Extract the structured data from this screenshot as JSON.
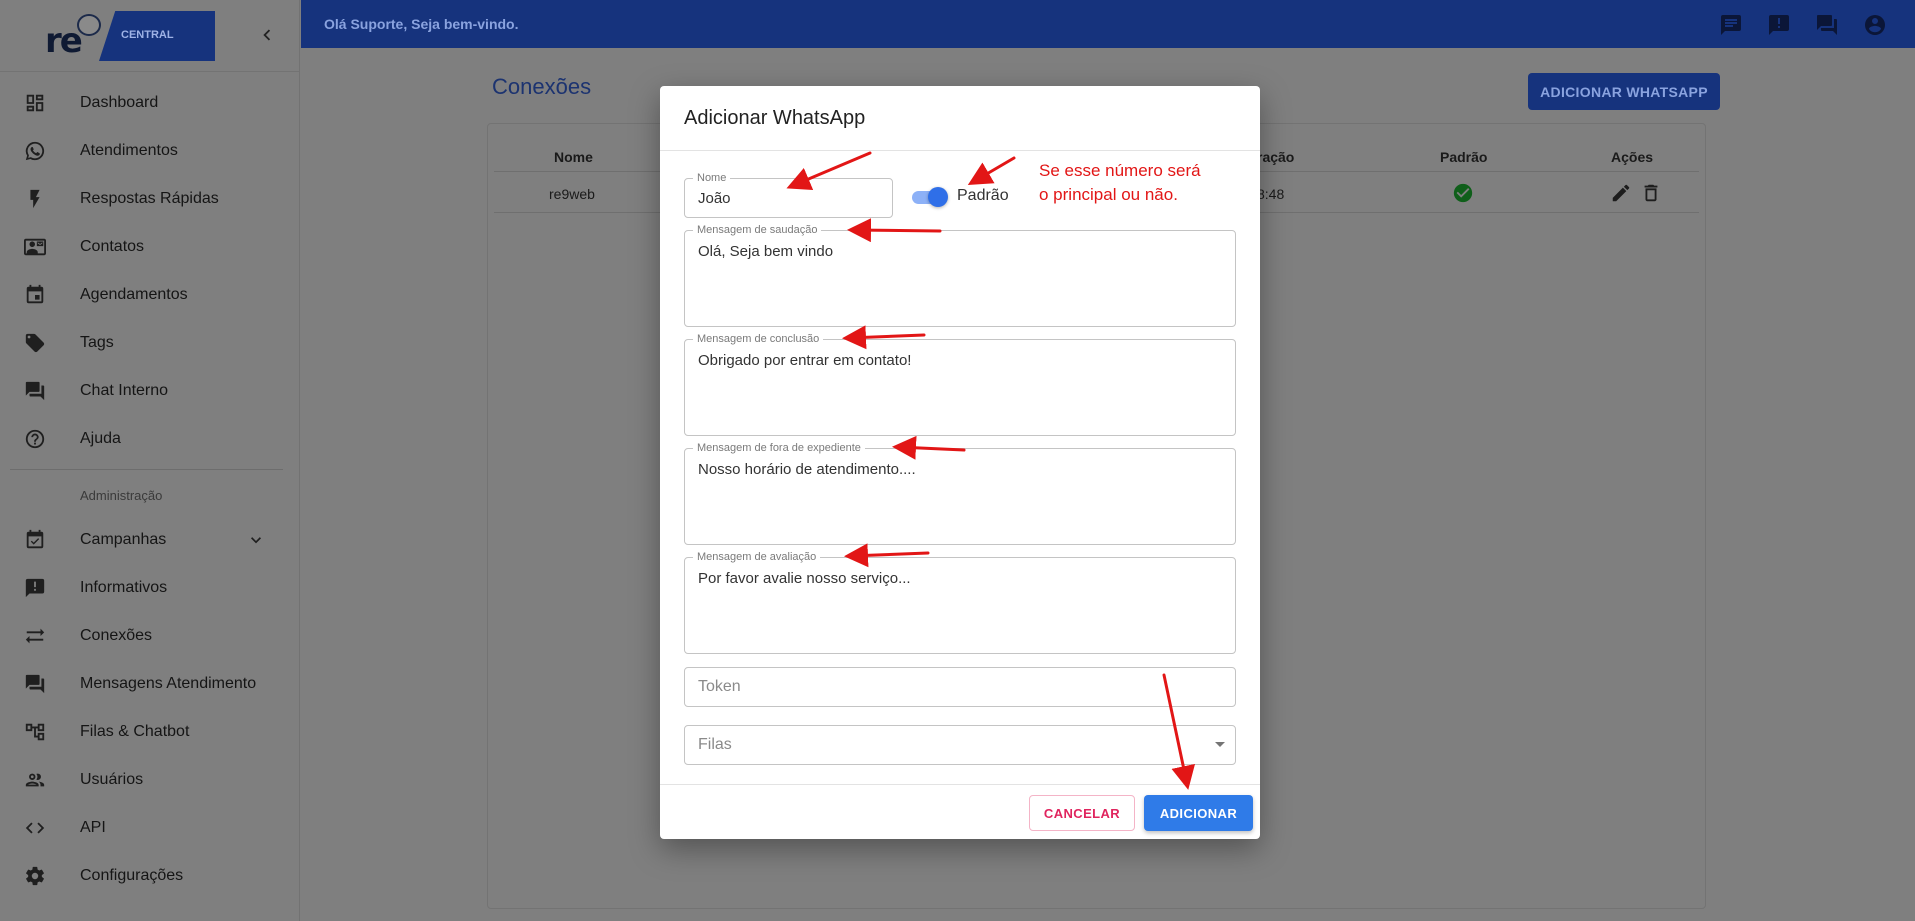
{
  "brand": {
    "logo_text": "re",
    "logo_sub": "CENTRAL"
  },
  "topbar": {
    "welcome": "Olá Suporte, Seja bem-vindo."
  },
  "sidebar": {
    "items": [
      {
        "label": "Dashboard",
        "icon": "dashboard-icon"
      },
      {
        "label": "Atendimentos",
        "icon": "whatsapp-icon"
      },
      {
        "label": "Respostas Rápidas",
        "icon": "flash-icon"
      },
      {
        "label": "Contatos",
        "icon": "contacts-icon"
      },
      {
        "label": "Agendamentos",
        "icon": "calendar-icon"
      },
      {
        "label": "Tags",
        "icon": "tag-icon"
      },
      {
        "label": "Chat Interno",
        "icon": "forum-icon"
      },
      {
        "label": "Ajuda",
        "icon": "help-icon"
      }
    ],
    "section_title": "Administração",
    "admin_items": [
      {
        "label": "Campanhas",
        "icon": "event-available-icon"
      },
      {
        "label": "Informativos",
        "icon": "announcement-icon"
      },
      {
        "label": "Conexões",
        "icon": "sync-alt-icon"
      },
      {
        "label": "Mensagens Atendimento",
        "icon": "forum-icon"
      },
      {
        "label": "Filas & Chatbot",
        "icon": "account-tree-icon"
      },
      {
        "label": "Usuários",
        "icon": "people-icon"
      },
      {
        "label": "API",
        "icon": "code-icon"
      },
      {
        "label": "Configurações",
        "icon": "settings-icon"
      }
    ]
  },
  "main": {
    "title": "Conexões",
    "add_button": "ADICIONAR WHATSAPP",
    "table": {
      "headers": {
        "name": "Nome",
        "updated": "ração",
        "default": "Padrão",
        "actions": "Ações"
      },
      "rows": [
        {
          "name": "re9web",
          "updated": "8:48"
        }
      ]
    }
  },
  "modal": {
    "title": "Adicionar WhatsApp",
    "name": {
      "label": "Nome",
      "value": "João"
    },
    "default_switch_label": "Padrão",
    "annotation_line1": "Se esse número será",
    "annotation_line2": "o principal ou não.",
    "greeting": {
      "label": "Mensagem de saudação",
      "value": "Olá, Seja bem vindo"
    },
    "conclusion": {
      "label": "Mensagem de conclusão",
      "value": "Obrigado por entrar em contato!"
    },
    "out_of_hours": {
      "label": "Mensagem de fora de expediente",
      "value": "Nosso horário de atendimento...."
    },
    "rating": {
      "label": "Mensagem de avaliação",
      "value": "Por favor avalie nosso serviço..."
    },
    "token_placeholder": "Token",
    "queues_placeholder": "Filas",
    "cancel": "CANCELAR",
    "submit": "ADICIONAR"
  },
  "colors": {
    "accent": "#2f7be8",
    "brand": "#16337d",
    "annotation": "#e21616",
    "success": "#0f5f1a"
  }
}
